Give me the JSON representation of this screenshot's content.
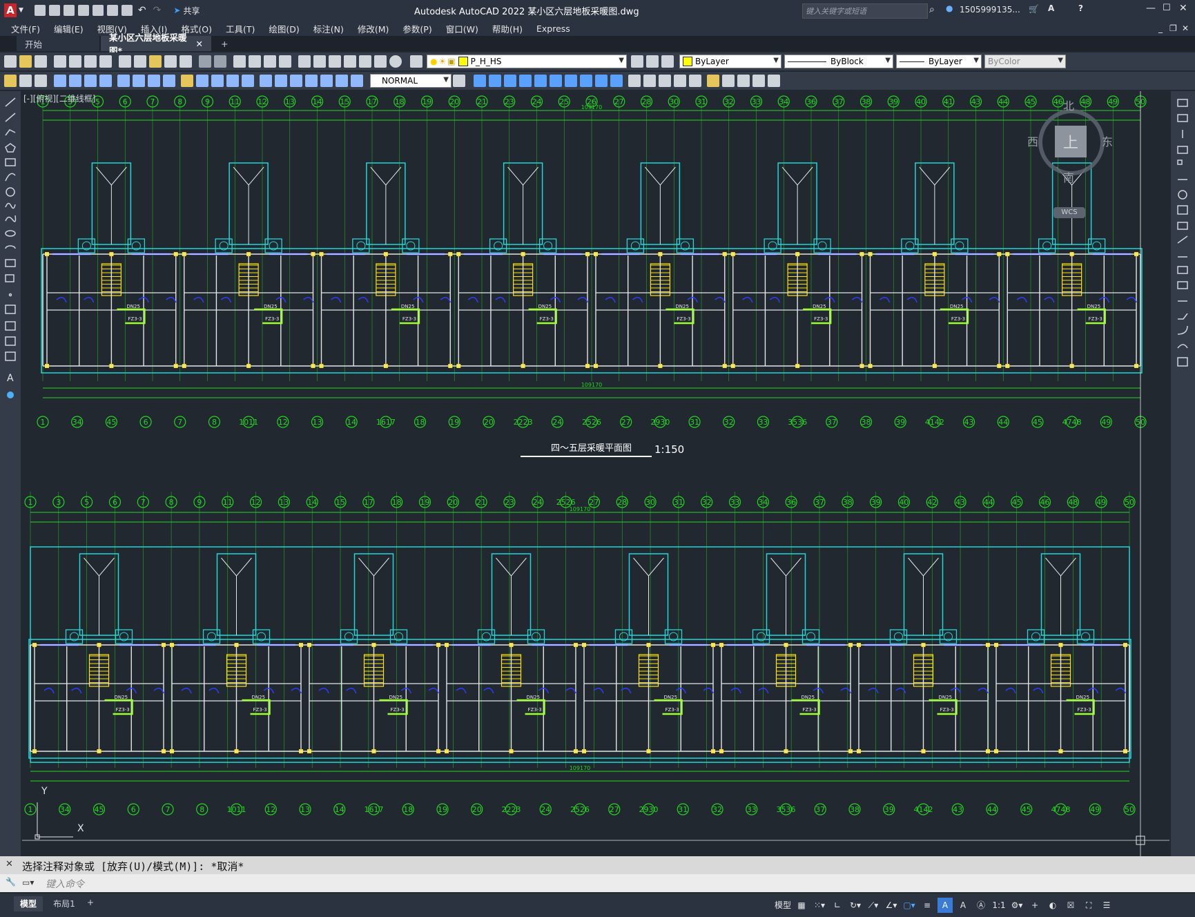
{
  "app": {
    "title": "Autodesk AutoCAD 2022    某小区六层地板采暖图.dwg",
    "share_label": "共享",
    "search_placeholder": "键入关键字或短语",
    "user": "1505999135...",
    "logo_letter": "A"
  },
  "menu": [
    "文件(F)",
    "编辑(E)",
    "视图(V)",
    "插入(I)",
    "格式(O)",
    "工具(T)",
    "绘图(D)",
    "标注(N)",
    "修改(M)",
    "参数(P)",
    "窗口(W)",
    "帮助(H)",
    "Express"
  ],
  "tabs": [
    {
      "label": "开始"
    },
    {
      "label": "某小区六层地板采暖图*"
    }
  ],
  "toolbar": {
    "layer": "P_H_HS",
    "color": "ByLayer",
    "linetype": "ByBlock",
    "lineweight": "ByLayer",
    "plotstyle": "ByColor",
    "textstyle": "NORMAL"
  },
  "viewport": {
    "label": "[-][俯视][二维线框]",
    "compass": {
      "north": "北",
      "south": "南",
      "east": "东",
      "west": "西",
      "center": "上",
      "wcs": "WCS"
    },
    "ucs_y": "Y",
    "ucs_x": "X"
  },
  "drawing": {
    "plan_title": "四～五层采暖平面图",
    "scale": "1:150",
    "grid_top_1": [
      "1",
      "3",
      "5",
      "6",
      "7",
      "8",
      "9",
      "11",
      "12",
      "13",
      "14",
      "15",
      "17",
      "18",
      "19",
      "20",
      "21",
      "23",
      "24",
      "25",
      "26",
      "27",
      "28",
      "30",
      "31",
      "32",
      "33",
      "34",
      "36",
      "37",
      "38",
      "39",
      "40",
      "41",
      "43",
      "44",
      "45",
      "46",
      "48",
      "49",
      "50"
    ],
    "grid_mid_1": [
      "1",
      "34",
      "45",
      "6",
      "7",
      "8",
      "1011",
      "12",
      "13",
      "14",
      "1617",
      "18",
      "19",
      "20",
      "2223",
      "24",
      "2526",
      "27",
      "2930",
      "31",
      "32",
      "33",
      "3536",
      "37",
      "38",
      "39",
      "4142",
      "43",
      "44",
      "45",
      "4748",
      "49",
      "50"
    ],
    "grid_top_2": [
      "1",
      "3",
      "5",
      "6",
      "7",
      "8",
      "9",
      "11",
      "12",
      "13",
      "14",
      "15",
      "17",
      "18",
      "19",
      "20",
      "21",
      "23",
      "24",
      "2526",
      "27",
      "28",
      "30",
      "31",
      "32",
      "33",
      "34",
      "36",
      "37",
      "38",
      "39",
      "40",
      "42",
      "43",
      "44",
      "45",
      "46",
      "48",
      "49",
      "50"
    ],
    "grid_bot_2": [
      "1",
      "34",
      "45",
      "6",
      "7",
      "8",
      "1011",
      "12",
      "13",
      "14",
      "1617",
      "18",
      "19",
      "20",
      "2223",
      "24",
      "2526",
      "27",
      "2930",
      "31",
      "32",
      "33",
      "3536",
      "37",
      "38",
      "39",
      "4142",
      "43",
      "44",
      "45",
      "4748",
      "49",
      "50"
    ],
    "dim_total": "109170",
    "room_labels": [
      "DN25",
      "FZ3-3"
    ]
  },
  "command": {
    "history": "选择注释对象或 [放弃(U)/模式(M)]: *取消*",
    "placeholder": "键入命令"
  },
  "status": {
    "layout_tabs": [
      "模型",
      "布局1"
    ],
    "model_label": "模型",
    "scale": "1:1"
  }
}
